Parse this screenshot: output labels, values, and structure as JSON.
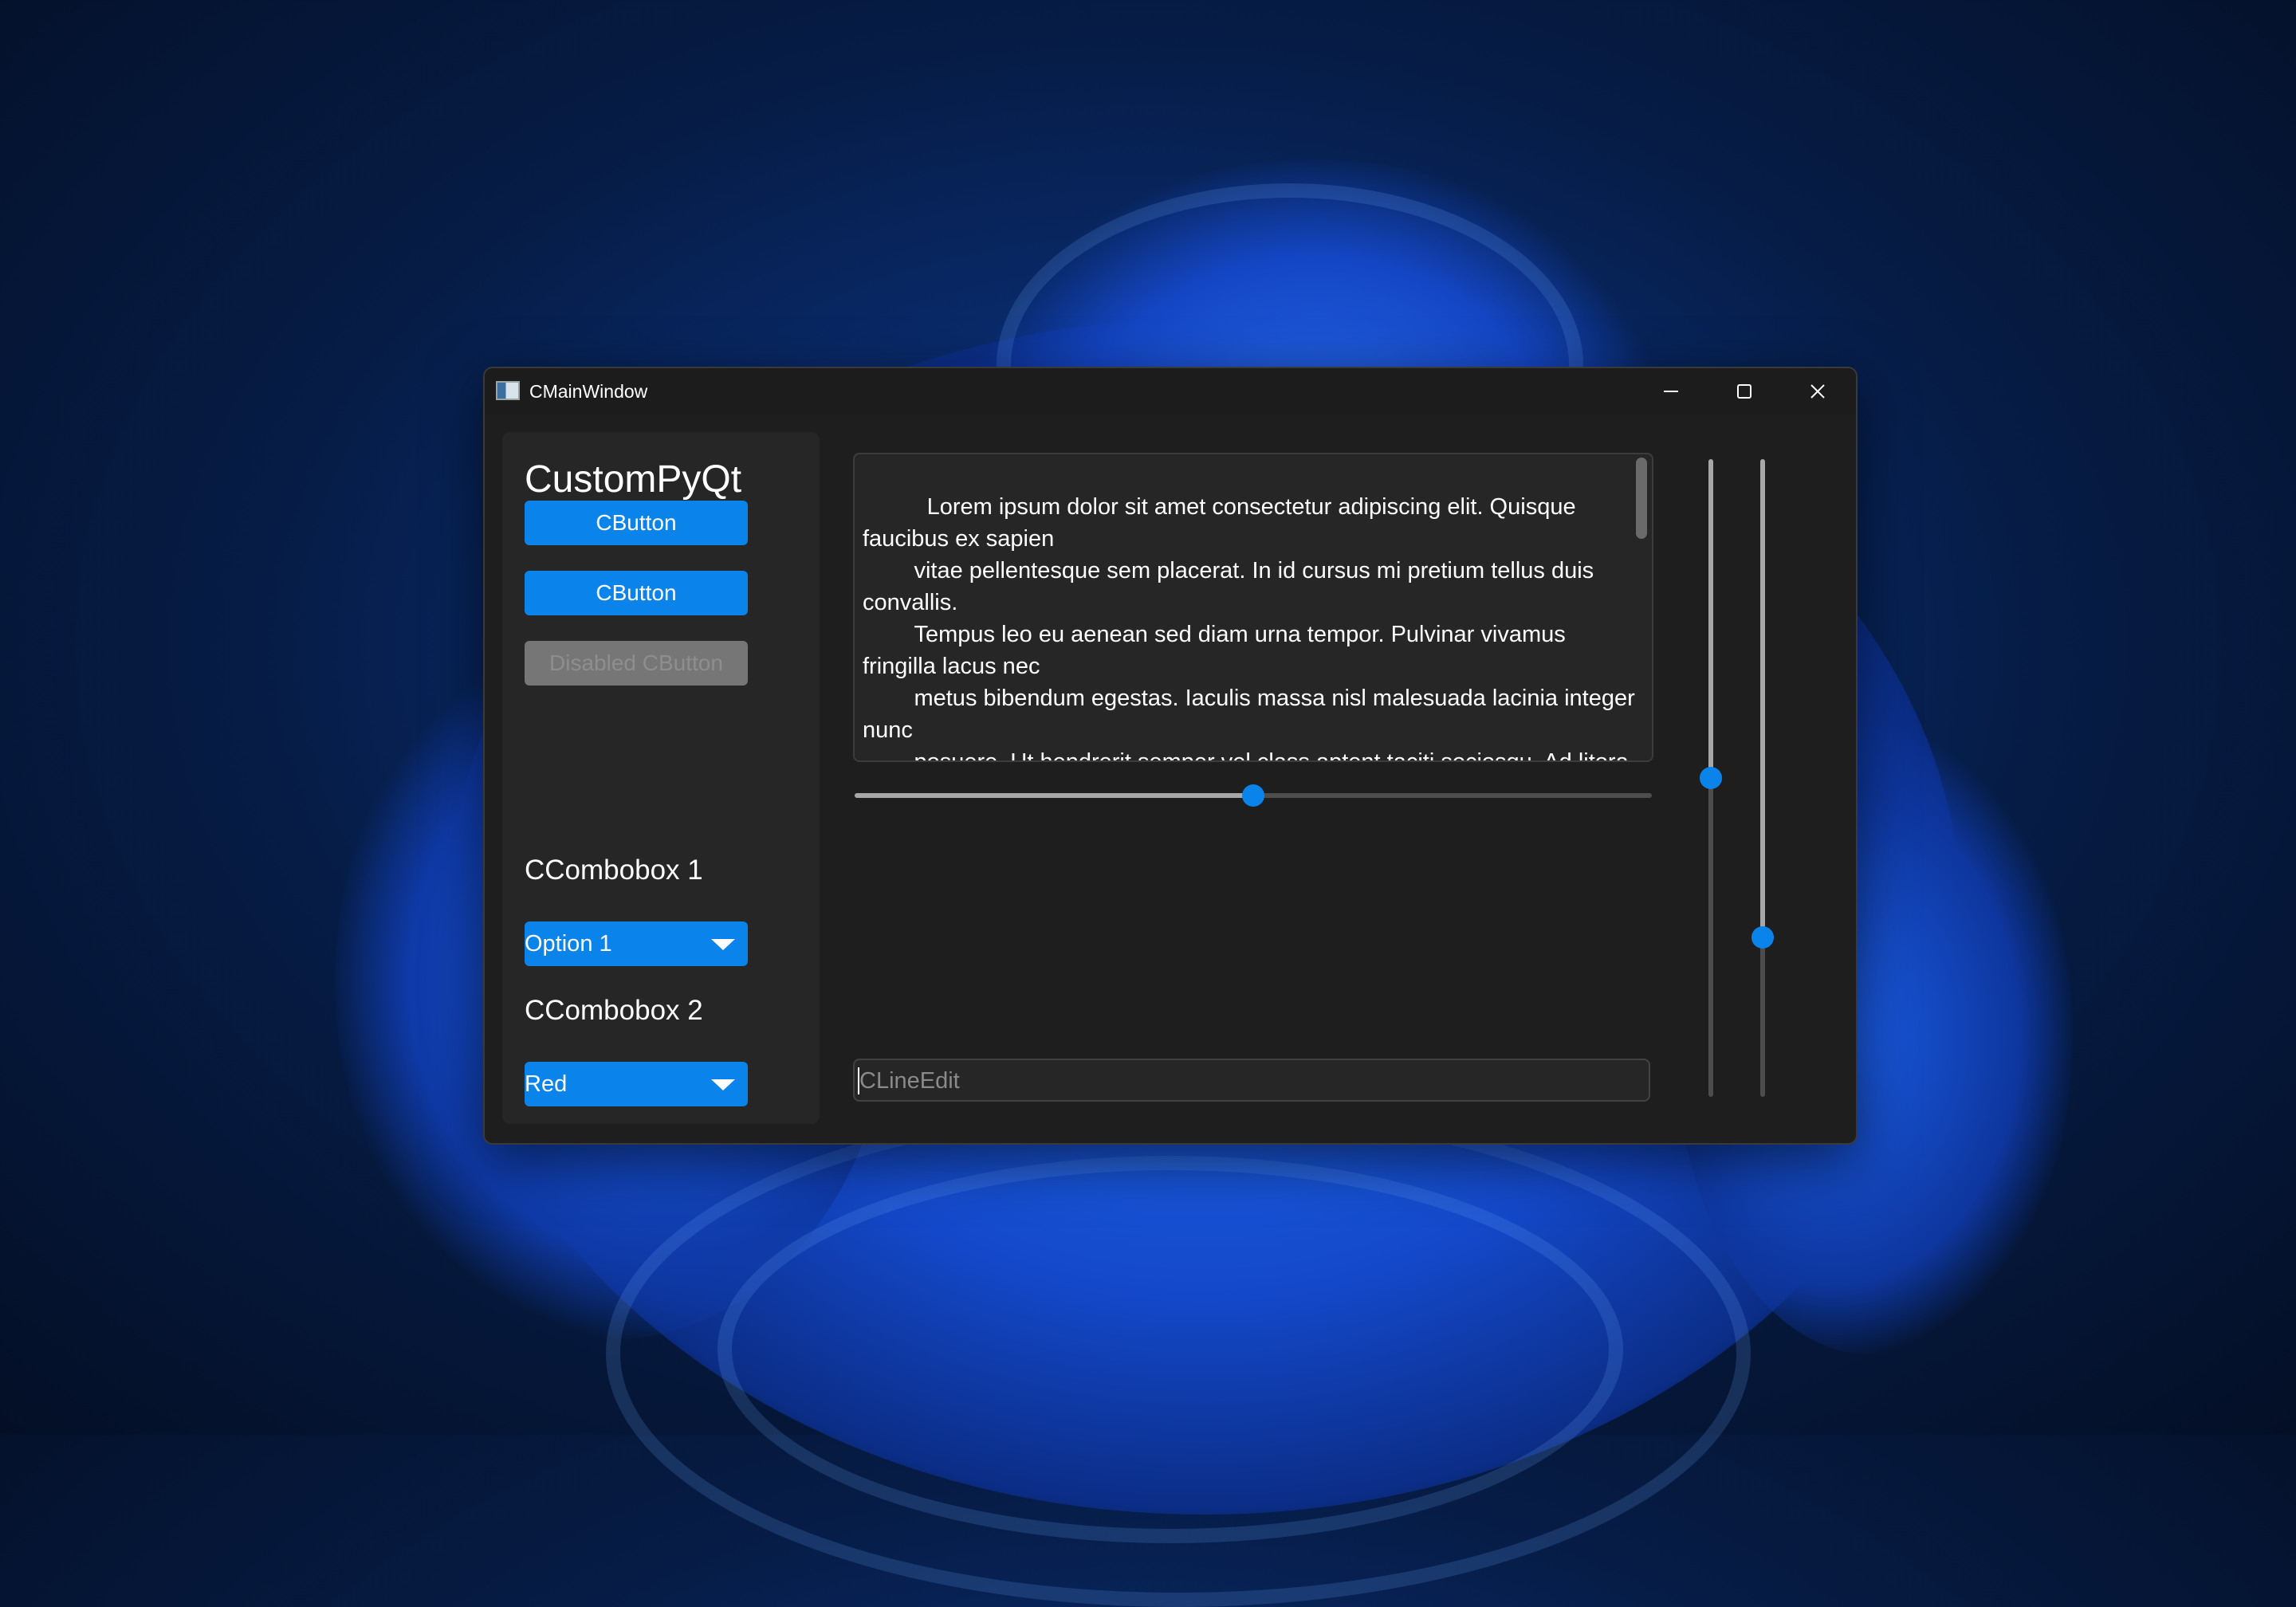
{
  "window": {
    "title": "CMainWindow",
    "controls": {
      "minimize": "minimize-icon",
      "maximize": "maximize-icon",
      "close": "close-icon"
    }
  },
  "sidebar": {
    "heading": "CustomPyQt",
    "buttons": [
      {
        "label": "CButton",
        "enabled": true
      },
      {
        "label": "CButton",
        "enabled": true
      },
      {
        "label": "Disabled CButton",
        "enabled": false
      }
    ],
    "combo1": {
      "label": "CCombobox 1",
      "value": "Option 1"
    },
    "combo2": {
      "label": "CCombobox 2",
      "value": "Red"
    }
  },
  "textedit": {
    "text": "          Lorem ipsum dolor sit amet consectetur adipiscing elit. Quisque faucibus ex sapien\n        vitae pellentesque sem placerat. In id cursus mi pretium tellus duis convallis.\n        Tempus leo eu aenean sed diam urna tempor. Pulvinar vivamus fringilla lacus nec\n        metus bibendum egestas. Iaculis massa nisl malesuada lacinia integer nunc\n        posuere. Ut hendrerit semper vel class aptent taciti sociosqu. Ad litora torquent"
  },
  "hslider": {
    "value": 0.5
  },
  "vslider1": {
    "value": 0.5
  },
  "vslider2": {
    "value": 0.25
  },
  "lineedit": {
    "placeholder": "CLineEdit",
    "value": ""
  },
  "colors": {
    "accent": "#0a84ea",
    "window_bg": "#1e1e1e",
    "panel_bg": "#262626",
    "disabled_bg": "#767676"
  }
}
